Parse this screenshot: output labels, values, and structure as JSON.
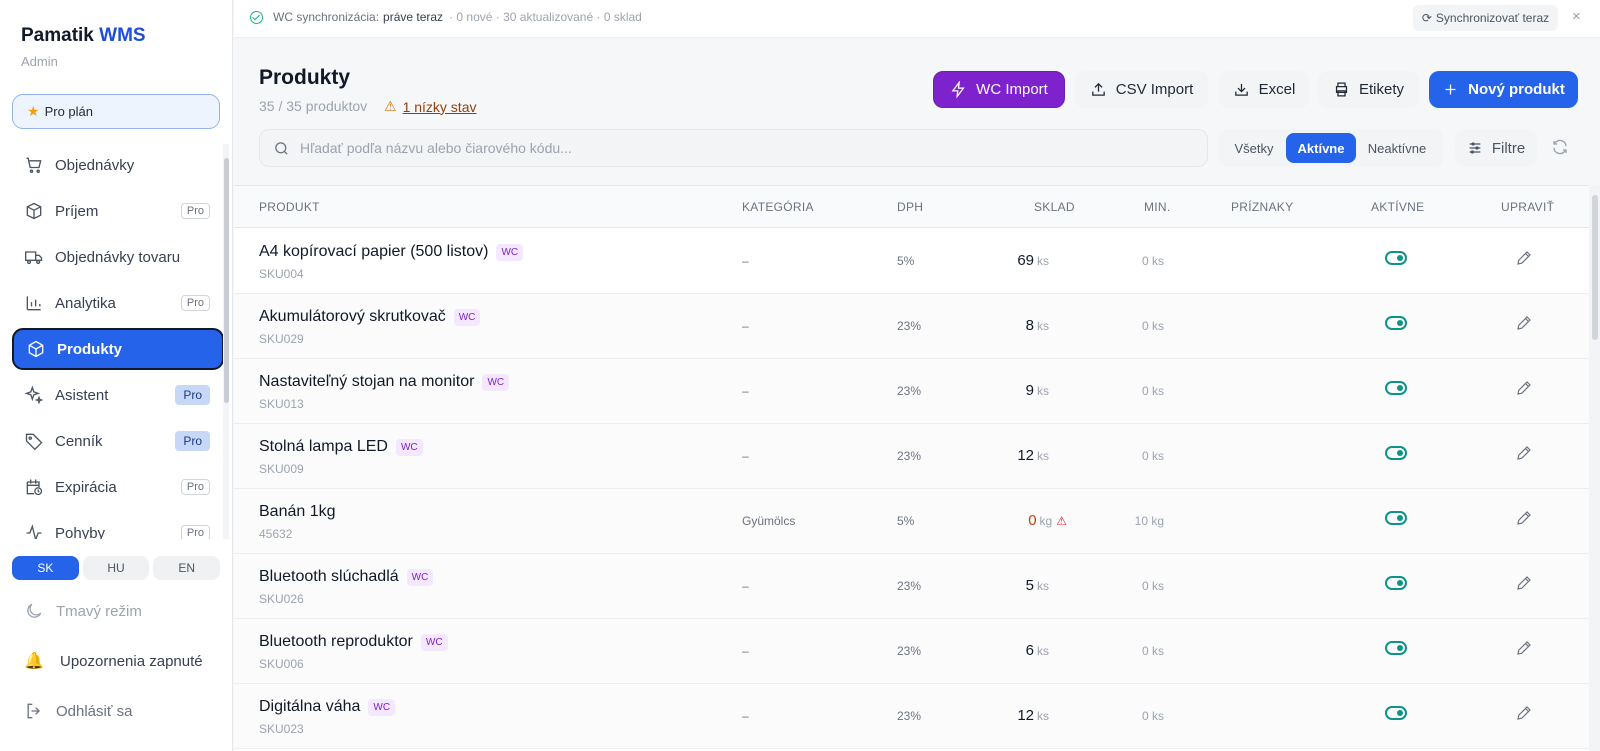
{
  "app": {
    "name_part1": "Pamatik",
    "name_part2": "WMS",
    "role": "Admin",
    "plan": "Pro plán"
  },
  "nav": [
    {
      "label": "Objednávky",
      "icon": "cart-icon",
      "badge": ""
    },
    {
      "label": "Príjem",
      "icon": "box-in-icon",
      "badge": "Pro"
    },
    {
      "label": "Objednávky tovaru",
      "icon": "truck-icon",
      "badge": ""
    },
    {
      "label": "Analytika",
      "icon": "bar-chart-icon",
      "badge": "Pro"
    },
    {
      "label": "Produkty",
      "icon": "cube-icon",
      "badge": "",
      "active": true
    },
    {
      "label": "Asistent",
      "icon": "sparkles-icon",
      "badge": "Pro"
    },
    {
      "label": "Cenník",
      "icon": "tag-icon",
      "badge": "Pro"
    },
    {
      "label": "Expirácia",
      "icon": "calendar-clock-icon",
      "badge": "Pro"
    },
    {
      "label": "Pohyby",
      "icon": "activity-icon",
      "badge": "Pro"
    }
  ],
  "languages": [
    "SK",
    "HU",
    "EN"
  ],
  "active_language": "SK",
  "dark_mode": "Tmavý režim",
  "notifications": "Upozornenia zapnuté",
  "logout": "Odhlásiť sa",
  "topbar": {
    "sync_label": "WC synchronizácia:",
    "sync_time": "práve teraz",
    "sync_stats": "· 0 nové · 30 aktualizované · 0 sklad",
    "sync_button": "Synchronizovať teraz",
    "close": "×"
  },
  "header": {
    "title": "Produkty",
    "count": "35 / 35 produktov",
    "low_stock": "1 nízky stav",
    "wc_import": "WC Import",
    "csv_import": "CSV Import",
    "excel": "Excel",
    "labels": "Etikety",
    "new_product": "Nový produkt"
  },
  "search": {
    "placeholder": "Hľadať podľa názvu alebo čiarového kódu...",
    "value": ""
  },
  "filter_tabs": [
    "Všetky",
    "Aktívne",
    "Neaktívne"
  ],
  "active_filter_tab": "Aktívne",
  "filters_button": "Filtre",
  "table": {
    "columns": [
      "PRODUKT",
      "KATEGÓRIA",
      "DPH",
      "SKLAD",
      "MIN.",
      "PRÍZNAKY",
      "AKTÍVNE",
      "UPRAVIŤ"
    ],
    "rows": [
      {
        "name": "A4 kopírovací papier (500 listov)",
        "wc": "WC",
        "sku": "SKU004",
        "category": "–",
        "vat": "5%",
        "stock": "69",
        "stock_unit": "ks",
        "min": "0 ks",
        "active": true
      },
      {
        "name": "Akumulátorový skrutkovač",
        "wc": "WC",
        "sku": "SKU029",
        "category": "–",
        "vat": "23%",
        "stock": "8",
        "stock_unit": "ks",
        "min": "0 ks",
        "active": true
      },
      {
        "name": "Nastaviteľný stojan na monitor",
        "wc": "WC",
        "sku": "SKU013",
        "category": "–",
        "vat": "23%",
        "stock": "9",
        "stock_unit": "ks",
        "min": "0 ks",
        "active": true
      },
      {
        "name": "Stolná lampa LED",
        "wc": "WC",
        "sku": "SKU009",
        "category": "–",
        "vat": "23%",
        "stock": "12",
        "stock_unit": "ks",
        "min": "0 ks",
        "active": true
      },
      {
        "name": "Banán 1kg",
        "wc": "",
        "sku": "45632",
        "category": "Gyümölcs",
        "vat": "5%",
        "stock": "0",
        "stock_unit": "kg",
        "min": "10 kg",
        "active": true,
        "low": true
      },
      {
        "name": "Bluetooth slúchadlá",
        "wc": "WC",
        "sku": "SKU026",
        "category": "–",
        "vat": "23%",
        "stock": "5",
        "stock_unit": "ks",
        "min": "0 ks",
        "active": true
      },
      {
        "name": "Bluetooth reproduktor",
        "wc": "WC",
        "sku": "SKU006",
        "category": "–",
        "vat": "23%",
        "stock": "6",
        "stock_unit": "ks",
        "min": "0 ks",
        "active": true
      },
      {
        "name": "Digitálna váha",
        "wc": "WC",
        "sku": "SKU023",
        "category": "–",
        "vat": "23%",
        "stock": "12",
        "stock_unit": "ks",
        "min": "0 ks",
        "active": true
      }
    ]
  },
  "colors": {
    "primary": "#2563eb",
    "wc_purple": "#7e22ce",
    "toggle_on": "#0d9488",
    "warning": "#d97706"
  }
}
